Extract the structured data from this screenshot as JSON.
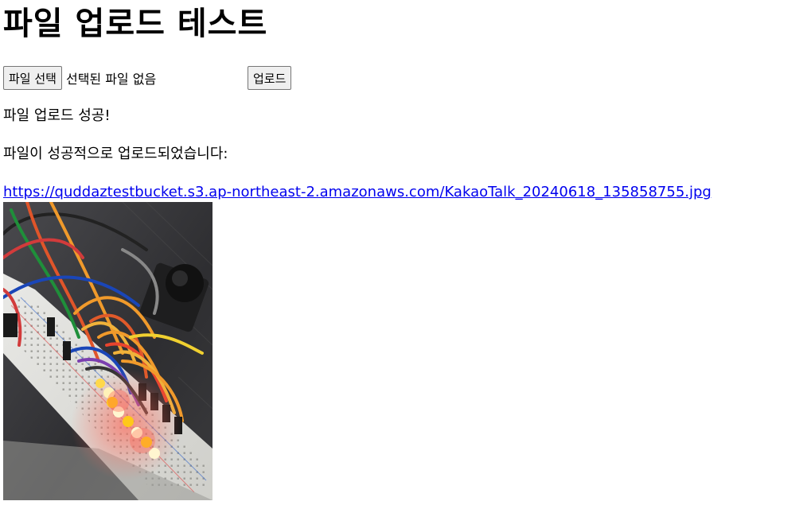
{
  "page": {
    "title": "파일 업로드 테스트"
  },
  "form": {
    "file_button_label": "파일 선택",
    "file_status": "선택된 파일 없음",
    "upload_button_label": "업로드"
  },
  "result": {
    "success_message": "파일 업로드 성공!",
    "detail_message": "파일이 성공적으로 업로드되었습니다:",
    "file_url": "https://quddaztestbucket.s3.ap-northeast-2.amazonaws.com/KakaoTalk_20240618_135858755.jpg"
  },
  "image": {
    "description_icon": "uploaded-photo-breadboard-leds"
  }
}
